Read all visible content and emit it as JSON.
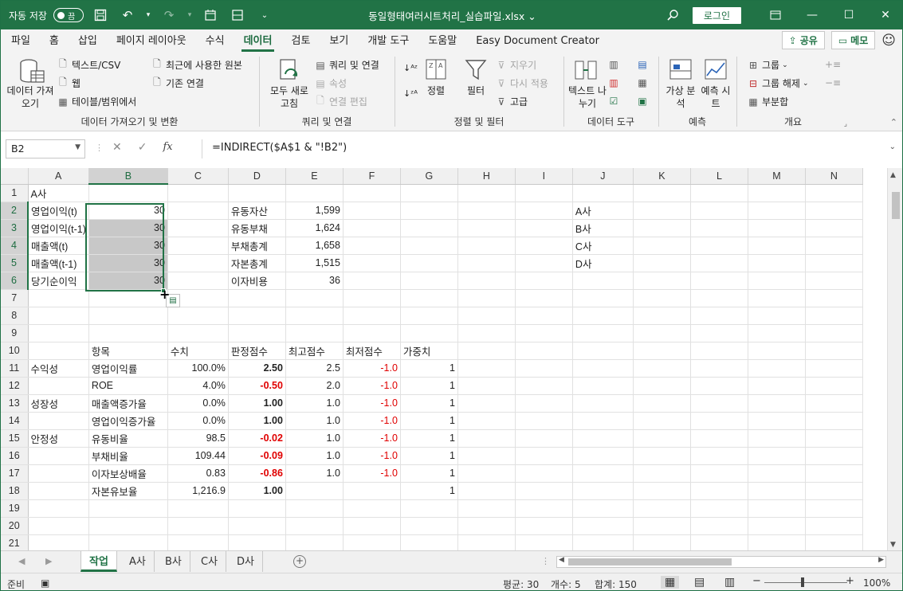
{
  "titlebar": {
    "autosave_label": "자동 저장",
    "autosave_state": "끔",
    "filename": "동일형태여러시트처리_실습파일.xlsx",
    "login_label": "로그인"
  },
  "menu": {
    "tabs": [
      "파일",
      "홈",
      "삽입",
      "페이지 레이아웃",
      "수식",
      "데이터",
      "검토",
      "보기",
      "개발 도구",
      "도움말",
      "Easy Document Creator"
    ],
    "active_tab": "데이터",
    "share_label": "공유",
    "memo_label": "메모"
  },
  "ribbon": {
    "get_data": {
      "big_button": "데이터 가져오기",
      "text_csv": "텍스트/CSV",
      "web": "웹",
      "table_range": "테이블/범위에서",
      "recent_sources": "최근에 사용한 원본",
      "existing_connections": "기존 연결",
      "group_label": "데이터 가져오기 및 변환"
    },
    "queries": {
      "refresh_all": "모두 새로 고침",
      "queries_connections": "쿼리 및 연결",
      "properties": "속성",
      "edit_links": "연결 편집",
      "group_label": "쿼리 및 연결"
    },
    "sort_filter": {
      "sort": "정렬",
      "filter": "필터",
      "clear": "지우기",
      "reapply": "다시 적용",
      "advanced": "고급",
      "group_label": "정렬 및 필터"
    },
    "data_tools": {
      "text_to_columns": "텍스트 나누기",
      "group_label": "데이터 도구"
    },
    "forecast": {
      "what_if": "가상 분석",
      "forecast_sheet": "예측 시트",
      "group_label": "예측"
    },
    "outline": {
      "group": "그룹",
      "ungroup": "그룹 해제",
      "subtotal": "부분합",
      "group_label": "개요"
    }
  },
  "formula_bar": {
    "name_box": "B2",
    "formula": "=INDIRECT($A$1 & \"!B2\")"
  },
  "sheet": {
    "columns": [
      "A",
      "B",
      "C",
      "D",
      "E",
      "F",
      "G",
      "H",
      "I",
      "J",
      "K",
      "L",
      "M",
      "N"
    ],
    "rows": [
      {
        "n": "1",
        "A": "A사",
        "B": "",
        "C": "",
        "D": "",
        "E": "",
        "F": "",
        "G": "",
        "J": ""
      },
      {
        "n": "2",
        "A": "영업이익(t)",
        "B": "30",
        "C": "",
        "D": "유동자산",
        "E": "1,599",
        "F": "",
        "G": "",
        "J": "A사"
      },
      {
        "n": "3",
        "A": "영업이익(t-1)",
        "B": "30",
        "C": "",
        "D": "유동부채",
        "E": "1,624",
        "F": "",
        "G": "",
        "J": "B사"
      },
      {
        "n": "4",
        "A": "매출액(t)",
        "B": "30",
        "C": "",
        "D": "부채총계",
        "E": "1,658",
        "F": "",
        "G": "",
        "J": "C사"
      },
      {
        "n": "5",
        "A": "매출액(t-1)",
        "B": "30",
        "C": "",
        "D": "자본총계",
        "E": "1,515",
        "F": "",
        "G": "",
        "J": "D사"
      },
      {
        "n": "6",
        "A": "당기순이익",
        "B": "30",
        "C": "",
        "D": "이자비용",
        "E": "36",
        "F": "",
        "G": "",
        "J": ""
      },
      {
        "n": "7",
        "A": "",
        "B": "",
        "C": "",
        "D": "",
        "E": "",
        "F": "",
        "G": "",
        "J": ""
      },
      {
        "n": "8",
        "A": "",
        "B": "",
        "C": "",
        "D": "",
        "E": "",
        "F": "",
        "G": "",
        "J": ""
      },
      {
        "n": "9",
        "A": "",
        "B": "",
        "C": "",
        "D": "",
        "E": "",
        "F": "",
        "G": "",
        "J": ""
      },
      {
        "n": "10",
        "A": "",
        "B": "항목",
        "C": "수치",
        "D": "판정점수",
        "E": "최고점수",
        "F": "최저점수",
        "G": "가중치",
        "J": ""
      },
      {
        "n": "11",
        "A": "수익성",
        "B": "영업이익률",
        "C": "100.0%",
        "D": "2.50",
        "E": "2.5",
        "F": "-1.0",
        "G": "1",
        "J": ""
      },
      {
        "n": "12",
        "A": "",
        "B": "ROE",
        "C": "4.0%",
        "D": "-0.50",
        "E": "2.0",
        "F": "-1.0",
        "G": "1",
        "J": ""
      },
      {
        "n": "13",
        "A": "성장성",
        "B": "매출액증가율",
        "C": "0.0%",
        "D": "1.00",
        "E": "1.0",
        "F": "-1.0",
        "G": "1",
        "J": ""
      },
      {
        "n": "14",
        "A": "",
        "B": "영업이익증가율",
        "C": "0.0%",
        "D": "1.00",
        "E": "1.0",
        "F": "-1.0",
        "G": "1",
        "J": ""
      },
      {
        "n": "15",
        "A": "안정성",
        "B": "유동비율",
        "C": "98.5",
        "D": "-0.02",
        "E": "1.0",
        "F": "-1.0",
        "G": "1",
        "J": ""
      },
      {
        "n": "16",
        "A": "",
        "B": "부채비율",
        "C": "109.44",
        "D": "-0.09",
        "E": "1.0",
        "F": "-1.0",
        "G": "1",
        "J": ""
      },
      {
        "n": "17",
        "A": "",
        "B": "이자보상배율",
        "C": "0.83",
        "D": "-0.86",
        "E": "1.0",
        "F": "-1.0",
        "G": "1",
        "J": ""
      },
      {
        "n": "18",
        "A": "",
        "B": "자본유보율",
        "C": "1,216.9",
        "D": "1.00",
        "E": "",
        "F": "",
        "G": "1",
        "J": ""
      },
      {
        "n": "19",
        "A": "",
        "B": "",
        "C": "",
        "D": "",
        "E": "",
        "F": "",
        "G": "",
        "J": ""
      },
      {
        "n": "20",
        "A": "",
        "B": "",
        "C": "",
        "D": "",
        "E": "",
        "F": "",
        "G": "",
        "J": ""
      },
      {
        "n": "21",
        "A": "",
        "B": "",
        "C": "",
        "D": "",
        "E": "",
        "F": "",
        "G": "",
        "J": ""
      }
    ]
  },
  "sheet_tabs": [
    "작업",
    "A사",
    "B사",
    "C사",
    "D사"
  ],
  "active_sheet": "작업",
  "status": {
    "ready": "준비",
    "average": "평균: 30",
    "count": "개수: 5",
    "sum": "합계: 150",
    "zoom": "100%"
  },
  "colors": {
    "accent": "#217346",
    "negative": "#e00000"
  }
}
